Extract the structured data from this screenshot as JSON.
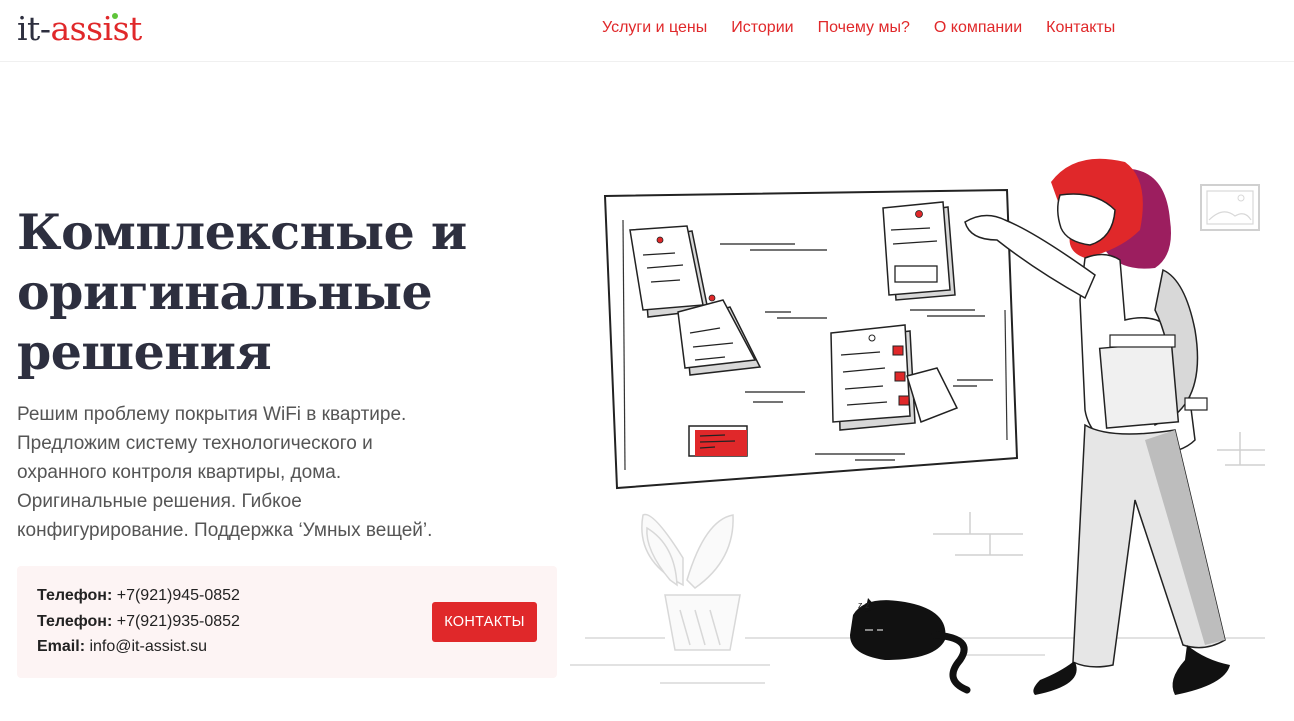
{
  "header": {
    "logo": {
      "part1": "it",
      "dash": "-",
      "part2": "assist"
    },
    "nav": [
      {
        "label": "Услуги и цены"
      },
      {
        "label": "Истории"
      },
      {
        "label": "Почему мы?"
      },
      {
        "label": "О компании"
      },
      {
        "label": "Контакты"
      }
    ]
  },
  "hero": {
    "title_lines": [
      "Комплексные и",
      "оригинальные",
      "решения"
    ],
    "description_lines": [
      "Решим проблему покрытия WiFi в квартире.",
      "Предложим систему технологического и",
      "охранного контроля квартиры, дома.",
      "Оригинальные решения. Гибкое",
      "конфигурирование. Поддержка ‘Умных вещей’."
    ]
  },
  "contacts": {
    "lines": [
      {
        "label": "Телефон:",
        "value": " +7(921)945-0852"
      },
      {
        "label": "Телефон:",
        "value": " +7(921)935-0852"
      },
      {
        "label": "Email:",
        "value": " info@it-assist.su"
      }
    ],
    "button_label": "КОНТАКТЫ"
  },
  "colors": {
    "accent": "#e0282a",
    "logo_dot": "#5fc43a",
    "title": "#2d2f3f",
    "contact_bg": "#fdf4f4"
  },
  "illustration": {
    "icons": [
      "corkboard-illustration",
      "woman-illustration",
      "cat-illustration",
      "plant-illustration",
      "picture-frame-icon"
    ]
  }
}
